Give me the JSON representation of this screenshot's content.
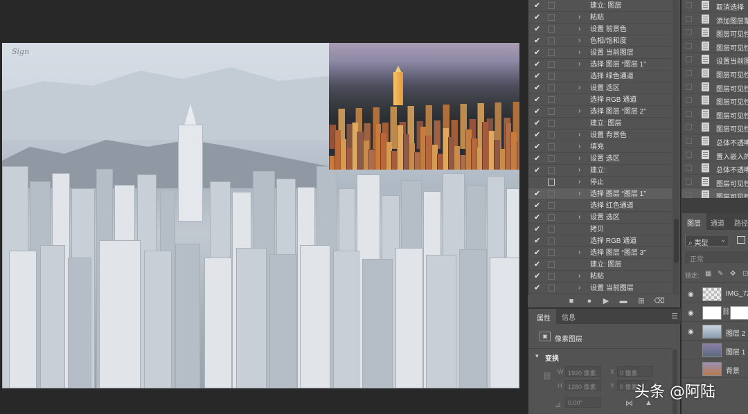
{
  "history_panel": {
    "items": [
      {
        "label": "建立: 图层",
        "checked": true,
        "expandable": false
      },
      {
        "label": "粘贴",
        "checked": true,
        "expandable": true
      },
      {
        "label": "设置 前景色",
        "checked": true,
        "expandable": true
      },
      {
        "label": "色相/饱和度",
        "checked": true,
        "expandable": true
      },
      {
        "label": "设置 当前图层",
        "checked": true,
        "expandable": true
      },
      {
        "label": "选择 图层 “图层 1”",
        "checked": true,
        "expandable": true
      },
      {
        "label": "选择 绿色通道",
        "checked": true,
        "expandable": false
      },
      {
        "label": "设置 选区",
        "checked": true,
        "expandable": true
      },
      {
        "label": "选择 RGB 通道",
        "checked": true,
        "expandable": false
      },
      {
        "label": "选择 图层 “图层 2”",
        "checked": true,
        "expandable": true
      },
      {
        "label": "建立: 图层",
        "checked": true,
        "expandable": false
      },
      {
        "label": "设置 背景色",
        "checked": true,
        "expandable": true
      },
      {
        "label": "填充",
        "checked": true,
        "expandable": true
      },
      {
        "label": "设置 选区",
        "checked": true,
        "expandable": true
      },
      {
        "label": "建立:",
        "checked": true,
        "expandable": true
      },
      {
        "label": "停止",
        "checked": false,
        "expandable": true
      },
      {
        "label": "选择 图层 “图层 1”",
        "checked": true,
        "expandable": true,
        "selected": true
      },
      {
        "label": "选择 红色通道",
        "checked": true,
        "expandable": false
      },
      {
        "label": "设置 选区",
        "checked": true,
        "expandable": true
      },
      {
        "label": "拷贝",
        "checked": true,
        "expandable": false
      },
      {
        "label": "选择 RGB 通道",
        "checked": true,
        "expandable": false
      },
      {
        "label": "选择 图层 “图层 3”",
        "checked": true,
        "expandable": true
      },
      {
        "label": "建立: 图层",
        "checked": true,
        "expandable": false
      },
      {
        "label": "粘贴",
        "checked": true,
        "expandable": true
      },
      {
        "label": "设置 当前图层",
        "checked": true,
        "expandable": true
      }
    ],
    "toolbar_icons": [
      "stop-icon",
      "record-icon",
      "play-icon",
      "folder-icon",
      "new-action-icon",
      "trash-icon"
    ]
  },
  "actions_panel": {
    "items": [
      "取消选择",
      "添加图层蒙",
      "图层可见性",
      "图层可见性",
      "设置当前图",
      "图层可见性",
      "图层可见性",
      "图层可见性",
      "图层可见性",
      "图层可见性",
      "总体不透明",
      "置入嵌入的",
      "总体不透明",
      "图层可见性",
      "图层可见性"
    ]
  },
  "properties_panel": {
    "tabs": [
      "属性",
      "信息"
    ],
    "layer_type": "像素图层",
    "section": "变换",
    "w_label": "W",
    "w_value": "1920 像素",
    "x_label": "X",
    "x_value": "0 像素",
    "h_label": "H",
    "h_value": "1280 像素",
    "y_label": "Y",
    "y_value": "0 像素",
    "angle_value": "0.00°"
  },
  "layers_panel": {
    "tabs": [
      "图层",
      "通道",
      "路径"
    ],
    "kind_filter": "类型",
    "blend_mode": "正常",
    "lock_label": "锁定:",
    "layers": [
      {
        "name": "IMG_72",
        "visible": true
      },
      {
        "name": "",
        "visible": true
      },
      {
        "name": "图层 2",
        "visible": true
      },
      {
        "name": "图层 1",
        "visible": false
      },
      {
        "name": "背景",
        "visible": false
      }
    ]
  },
  "watermark": "头条 @阿陆"
}
